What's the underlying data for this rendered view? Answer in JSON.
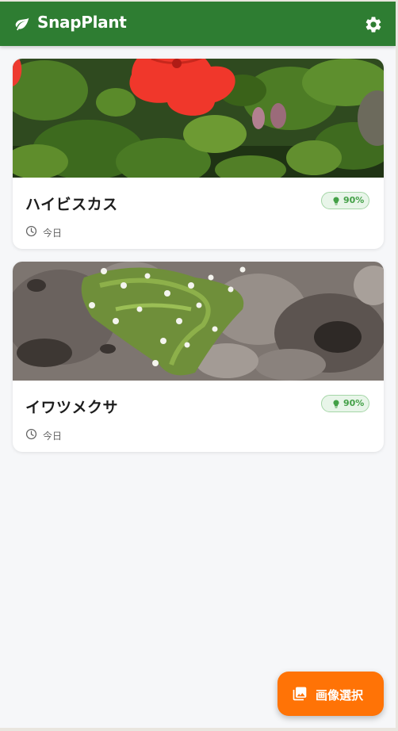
{
  "app": {
    "title": "SnapPlant",
    "header_color": "#2e7d32",
    "header_icon": "leaf-icon",
    "settings_icon": "gear-icon"
  },
  "plants": [
    {
      "name": "ハイビスカス",
      "confidence": "90%",
      "date": "今日",
      "photo": "hibiscus-photo"
    },
    {
      "name": "イワツメクサ",
      "confidence": "90%",
      "date": "今日",
      "photo": "stellaria-photo"
    }
  ],
  "fab": {
    "label": "画像選択",
    "icon": "gallery-icon",
    "color": "#ff7306"
  },
  "colors": {
    "badge_text": "#43a047",
    "badge_bg": "#e8f5e9"
  }
}
